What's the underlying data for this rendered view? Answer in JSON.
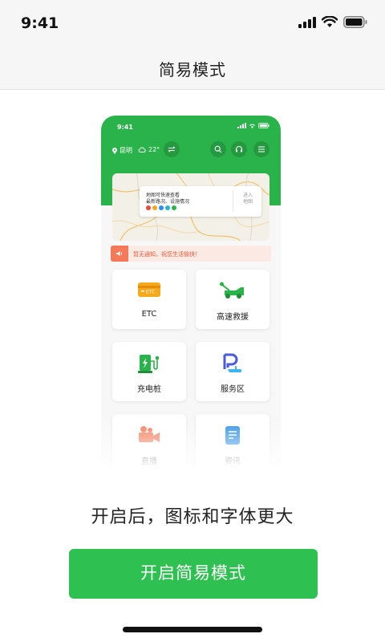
{
  "status_bar": {
    "time": "9:41"
  },
  "nav": {
    "title": "简易模式"
  },
  "preview": {
    "time": "9:41",
    "location": "昆明",
    "temperature": "22°",
    "map_card": {
      "line1": "地图可快速查看",
      "line2": "最新路况、设施情况",
      "enter_label": "进入\n地图"
    },
    "notice": "暂无通知，祝您生活愉快！",
    "tiles": [
      {
        "label": "ETC",
        "icon": "etc-card-icon",
        "badge": "ETC"
      },
      {
        "label": "高速救援",
        "icon": "tow-truck-icon"
      },
      {
        "label": "充电桩",
        "icon": "charging-pile-icon"
      },
      {
        "label": "服务区",
        "icon": "service-area-icon"
      },
      {
        "label": "直播",
        "icon": "camera-icon"
      },
      {
        "label": "资讯",
        "icon": "document-icon"
      }
    ]
  },
  "description": "开启后，图标和字体更大",
  "enable_button": {
    "label": "开启简易模式"
  },
  "colors": {
    "brand_green": "#2bb34b",
    "button_green": "#2ec050",
    "notice_red": "#f47a5a"
  }
}
